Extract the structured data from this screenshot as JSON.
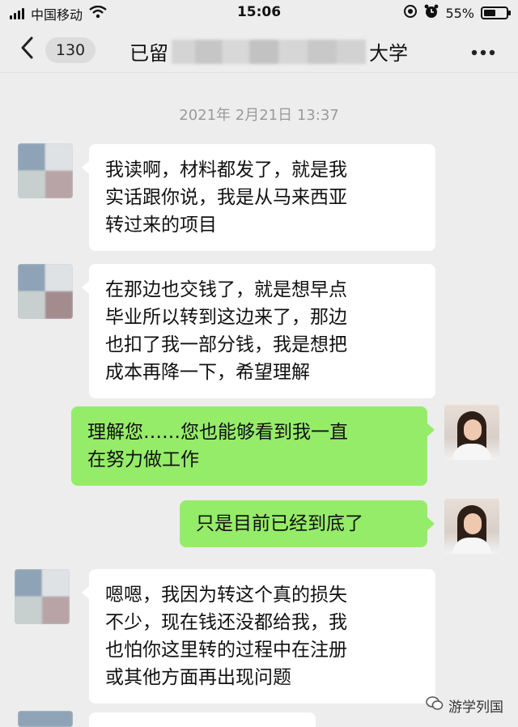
{
  "status_bar": {
    "carrier": "中国移动",
    "time": "15:06",
    "battery_percent_label": "55%",
    "battery_level": 0.55,
    "icons": [
      "signal-icon",
      "wifi-icon",
      "location-icon",
      "alarm-icon",
      "battery-icon"
    ]
  },
  "nav": {
    "back_icon": "chevron-left-icon",
    "unread_count": "130",
    "title_prefix": "已留",
    "title_suffix": "大学",
    "more_icon": "ellipsis-icon"
  },
  "chat": {
    "timestamp": "2021年 2月21日  13:37",
    "messages": [
      {
        "direction": "incoming",
        "lines": [
          "我读啊，材料都发了，就是我",
          "实话跟你说，我是从马来西亚",
          "转过来的项目"
        ]
      },
      {
        "direction": "incoming",
        "lines": [
          "在那边也交钱了，就是想早点",
          "毕业所以转到这边来了，那边",
          "也扣了我一部分钱，我是想把",
          "成本再降一下，希望理解"
        ]
      },
      {
        "direction": "outgoing",
        "lines": [
          "理解您……您也能够看到我一直",
          "在努力做工作"
        ]
      },
      {
        "direction": "outgoing",
        "lines": [
          "只是目前已经到底了"
        ]
      },
      {
        "direction": "incoming",
        "lines": [
          "嗯嗯，我因为转这个真的损失",
          "不少，现在钱还没都给我，我",
          "也怕你这里转的过程中在注册",
          "或其他方面再出现问题"
        ]
      }
    ]
  },
  "watermark": {
    "text": "游学列国",
    "icon": "wechat-icon"
  },
  "colors": {
    "background": "#ededed",
    "incoming_bubble": "#ffffff",
    "outgoing_bubble": "#95ec69",
    "timestamp_text": "#9a9a9a"
  }
}
